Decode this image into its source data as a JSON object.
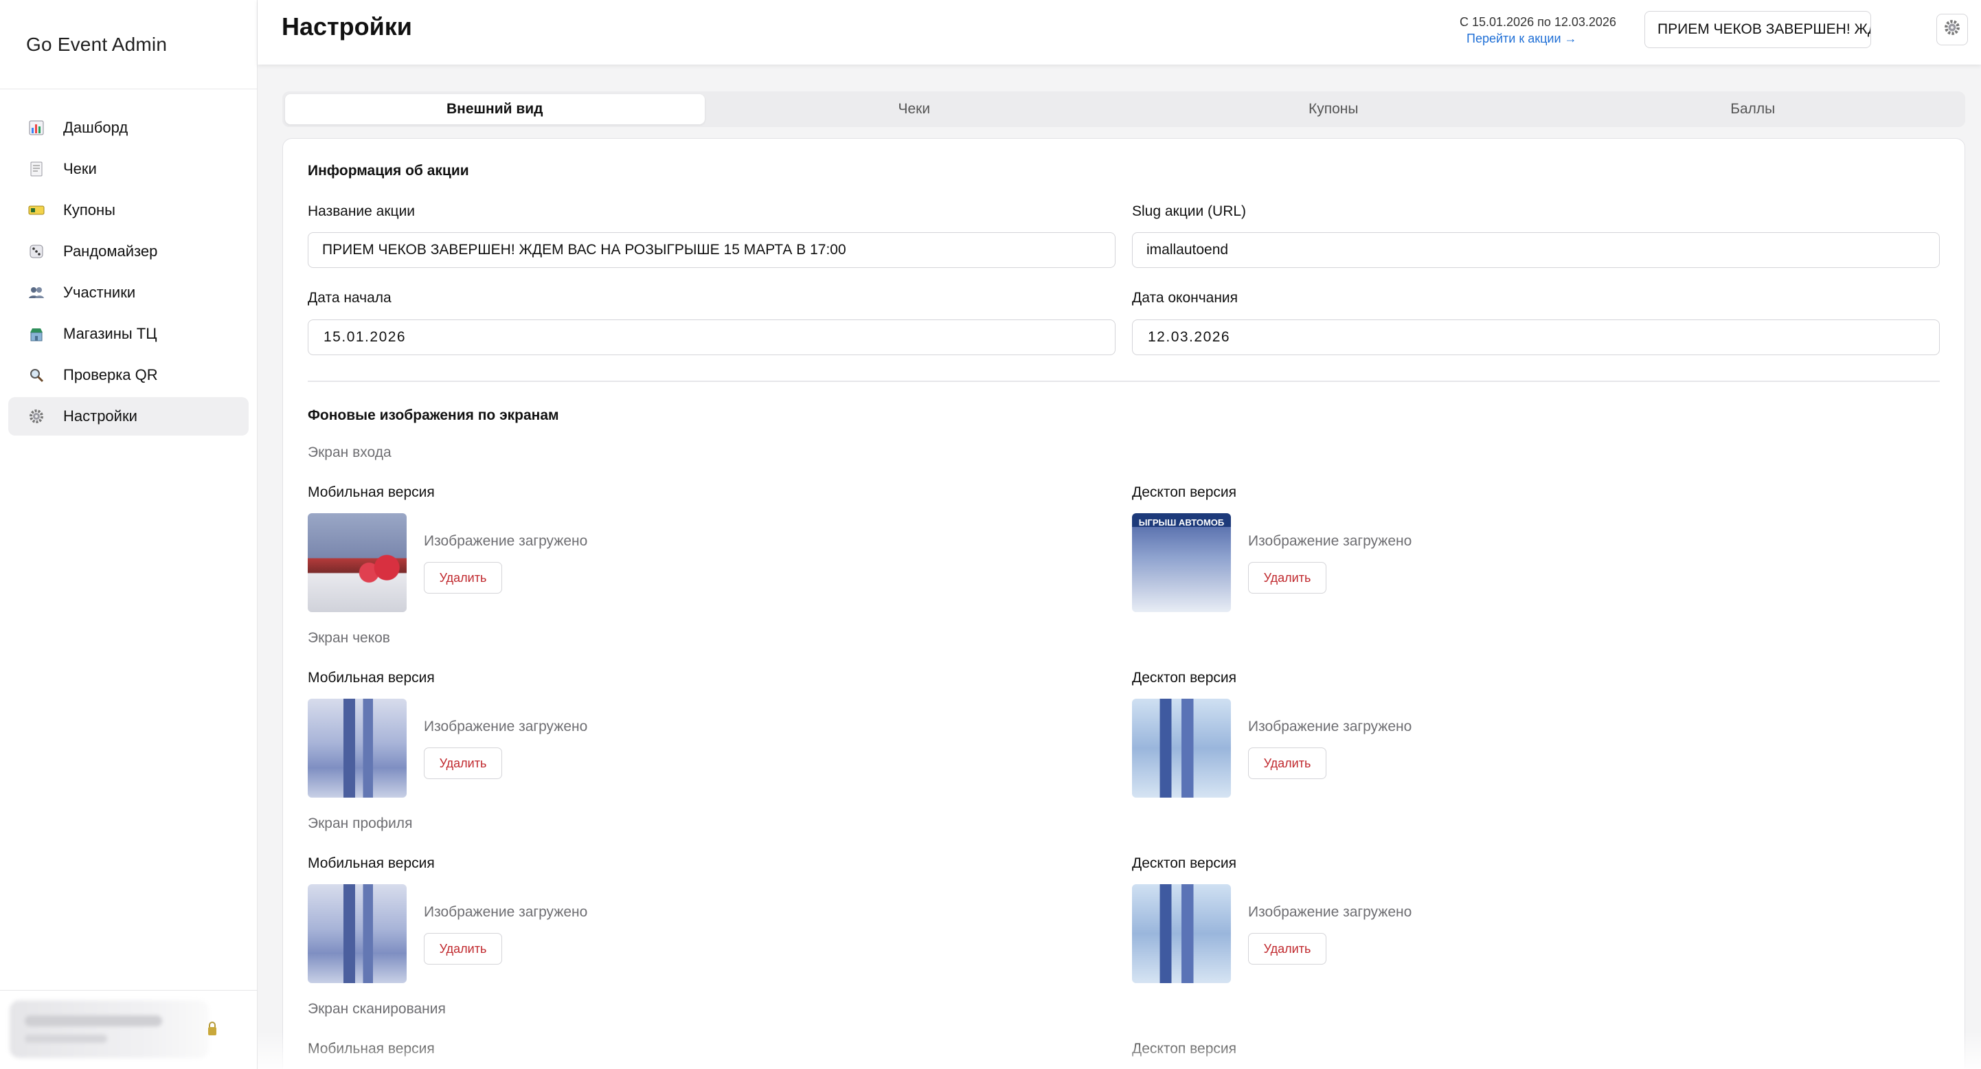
{
  "sidebar": {
    "brand": "Go Event Admin",
    "items": [
      {
        "label": "Дашборд",
        "icon": "chart-icon"
      },
      {
        "label": "Чеки",
        "icon": "receipt-icon"
      },
      {
        "label": "Купоны",
        "icon": "ticket-icon"
      },
      {
        "label": "Рандомайзер",
        "icon": "dice-icon"
      },
      {
        "label": "Участники",
        "icon": "users-icon"
      },
      {
        "label": "Магазины ТЦ",
        "icon": "store-icon"
      },
      {
        "label": "Проверка QR",
        "icon": "search-icon"
      },
      {
        "label": "Настройки",
        "icon": "gear-icon",
        "active": true
      }
    ]
  },
  "header": {
    "title": "Настройки",
    "dates": "С 15.01.2026 по 12.03.2026",
    "goto_link": "Перейти к акции →",
    "promo_select": "ПРИЕМ ЧЕКОВ ЗАВЕРШЕН! ЖДЕ"
  },
  "tabs": [
    "Внешний вид",
    "Чеки",
    "Купоны",
    "Баллы"
  ],
  "info": {
    "section_title": "Информация об акции",
    "name_label": "Название акции",
    "name_value": "ПРИЕМ ЧЕКОВ ЗАВЕРШЕН! ЖДЕМ ВАС НА РОЗЫГРЫШЕ 15 МАРТА В 17:00",
    "slug_label": "Slug акции (URL)",
    "slug_value": "imallautoend",
    "start_label": "Дата начала",
    "start_value": "15.01.2026",
    "end_label": "Дата окончания",
    "end_value": "12.03.2026"
  },
  "backgrounds": {
    "section_title": "Фоновые изображения по экранам",
    "mobile_label": "Мобильная версия",
    "desktop_label": "Десктоп версия",
    "status": "Изображение загружено",
    "delete_label": "Удалить",
    "desktop_thumb_text": "ЫГРЫШ АВТОМОБ",
    "screens": [
      "Экран входа",
      "Экран чеков",
      "Экран профиля",
      "Экран сканирования"
    ]
  }
}
